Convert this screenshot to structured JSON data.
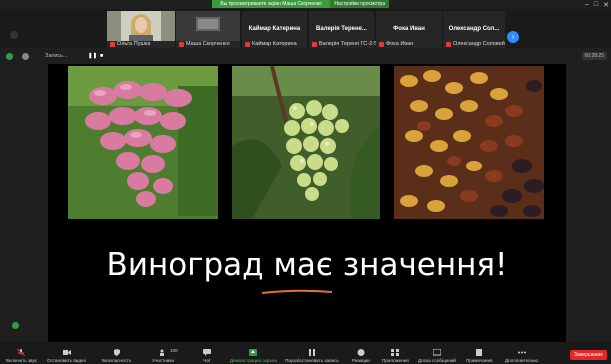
{
  "share_banner": {
    "message": "Вы просматриваете экран Маша Скорченко",
    "options_button": "Настройки просмотра"
  },
  "window_controls": [
    "–",
    "□",
    "✕"
  ],
  "participants": [
    {
      "name": "Ольга Пушка",
      "has_video": true
    },
    {
      "name": "Маша Скорченко",
      "has_video": true
    },
    {
      "name": "Каймар Катерина",
      "has_video": false
    },
    {
      "name": "Валерія Терене...",
      "label": "Валерія Тереня ГС-2-5",
      "has_video": false
    },
    {
      "name": "Фока Иван",
      "has_video": false
    },
    {
      "name": "Олександр Сол...",
      "label": "Олександр Соловей",
      "has_video": false
    }
  ],
  "subbar": {
    "record_label": "Запись...",
    "timer": "00:28:25"
  },
  "slide": {
    "title": "Виноград має значення!",
    "accent_color": "#e8702a"
  },
  "toolbar": {
    "items": [
      {
        "label": "Включить звук",
        "icon": "mic-icon"
      },
      {
        "label": "Остановить видео",
        "icon": "video-icon"
      },
      {
        "label": "Безопасность",
        "icon": "shield-icon"
      },
      {
        "label": "Участники",
        "icon": "participants-icon",
        "count": "100"
      },
      {
        "label": "Чат",
        "icon": "chat-icon"
      },
      {
        "label": "Демонстрация экрана",
        "icon": "share-screen-icon"
      },
      {
        "label": "Пауза/остановить запись",
        "icon": "pause-record-icon"
      },
      {
        "label": "Реакции",
        "icon": "reaction-icon"
      },
      {
        "label": "Приложения",
        "icon": "apps-icon"
      },
      {
        "label": "Доска сообщений",
        "icon": "whiteboard-icon"
      },
      {
        "label": "Примечания",
        "icon": "notes-icon"
      },
      {
        "label": "Дополнительно",
        "icon": "more-icon"
      }
    ],
    "end_label": "Завершение"
  }
}
